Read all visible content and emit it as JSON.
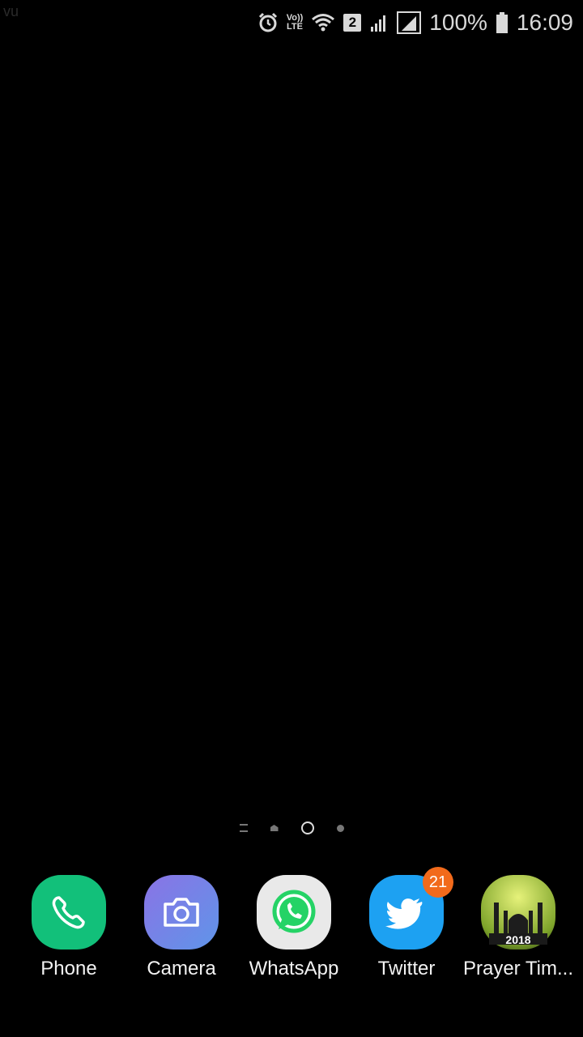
{
  "corner_text": "vu",
  "status_bar": {
    "icons": [
      "alarm-icon",
      "volte-lte-icon",
      "wifi-icon",
      "sim-2-icon",
      "signal-icon",
      "signal-icon"
    ],
    "volte_top": "Vo))",
    "volte_bottom": "LTE",
    "sim_number": "2",
    "battery_percent": "100%",
    "time": "16:09"
  },
  "page_indicator": {
    "pages": 4,
    "current_index": 2
  },
  "dock": {
    "apps": [
      {
        "label": "Phone",
        "icon": "phone-icon",
        "color": "#12c07a"
      },
      {
        "label": "Camera",
        "icon": "camera-icon",
        "color": "#6f7be0"
      },
      {
        "label": "WhatsApp",
        "icon": "whatsapp-icon",
        "color": "#ececec"
      },
      {
        "label": "Twitter",
        "icon": "twitter-bird-icon",
        "color": "#1da1f2",
        "badge": "21"
      },
      {
        "label": "Prayer Tim...",
        "icon": "mosque-icon",
        "color": "#c7d94a",
        "icon_text": "2018"
      }
    ]
  },
  "colors": {
    "background": "#000000",
    "badge": "#f26a1b"
  }
}
